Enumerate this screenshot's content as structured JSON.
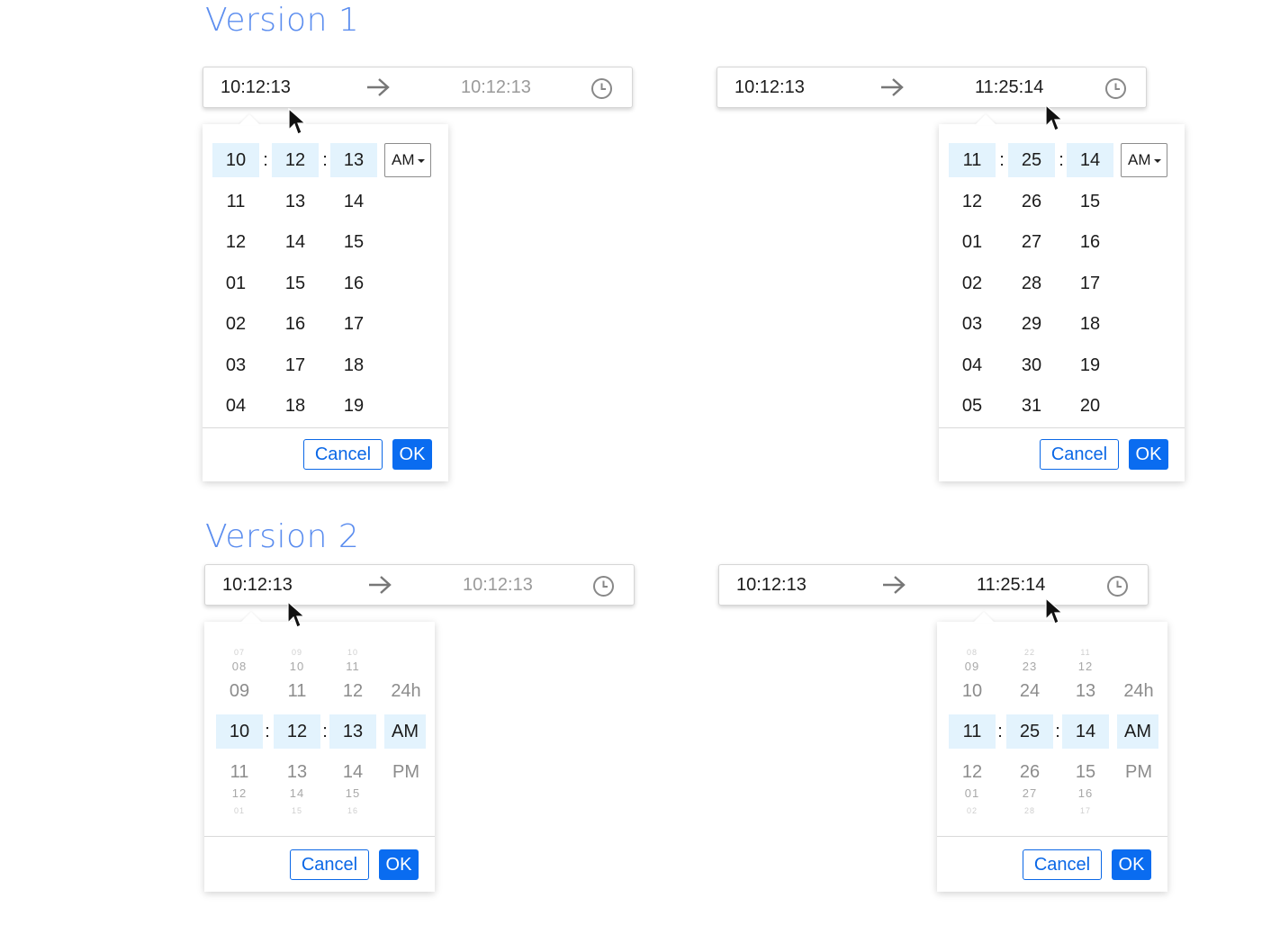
{
  "headings": {
    "v1": "Version 1",
    "v2": "Version 2"
  },
  "picker_a": {
    "start": "10:12:13",
    "end": "10:12:13",
    "hours": [
      "10",
      "11",
      "12",
      "01",
      "02",
      "03",
      "04"
    ],
    "minutes": [
      "12",
      "13",
      "14",
      "15",
      "16",
      "17",
      "18"
    ],
    "seconds": [
      "13",
      "14",
      "15",
      "16",
      "17",
      "18",
      "19"
    ],
    "ampm": "AM",
    "cancel": "Cancel",
    "ok": "OK"
  },
  "picker_b": {
    "start": "10:12:13",
    "end": "11:25:14",
    "hours": [
      "11",
      "12",
      "01",
      "02",
      "03",
      "04",
      "05"
    ],
    "minutes": [
      "25",
      "26",
      "27",
      "28",
      "29",
      "30",
      "31"
    ],
    "seconds": [
      "14",
      "15",
      "16",
      "17",
      "18",
      "19",
      "20"
    ],
    "ampm": "AM",
    "cancel": "Cancel",
    "ok": "OK"
  },
  "picker_c": {
    "start": "10:12:13",
    "end": "10:12:13",
    "hours_before": [
      "07",
      "08",
      "09"
    ],
    "hour": "10",
    "hours_after": [
      "11",
      "12",
      "01"
    ],
    "minutes_before": [
      "09",
      "10",
      "11"
    ],
    "minute": "12",
    "minutes_after": [
      "13",
      "14",
      "15"
    ],
    "seconds_before": [
      "10",
      "11",
      "12"
    ],
    "second": "13",
    "seconds_after": [
      "14",
      "15",
      "16"
    ],
    "modes": [
      "24h",
      "AM",
      "PM"
    ],
    "cancel": "Cancel",
    "ok": "OK"
  },
  "picker_d": {
    "start": "10:12:13",
    "end": "11:25:14",
    "hours_before": [
      "08",
      "09",
      "10"
    ],
    "hour": "11",
    "hours_after": [
      "12",
      "01",
      "02"
    ],
    "minutes_before": [
      "22",
      "23",
      "24"
    ],
    "minute": "25",
    "minutes_after": [
      "26",
      "27",
      "28"
    ],
    "seconds_before": [
      "11",
      "12",
      "13"
    ],
    "second": "14",
    "seconds_after": [
      "15",
      "16",
      "17"
    ],
    "modes": [
      "24h",
      "AM",
      "PM"
    ],
    "cancel": "Cancel",
    "ok": "OK"
  },
  "icons": {
    "arrow": "arrow-right-icon",
    "clock": "clock-icon",
    "cursor": "mouse-cursor-icon",
    "dropdown": "caret-down-icon"
  },
  "colors": {
    "accent": "#0a6cf0",
    "heading": "#5b8def",
    "selected": "#e3f3fd"
  }
}
